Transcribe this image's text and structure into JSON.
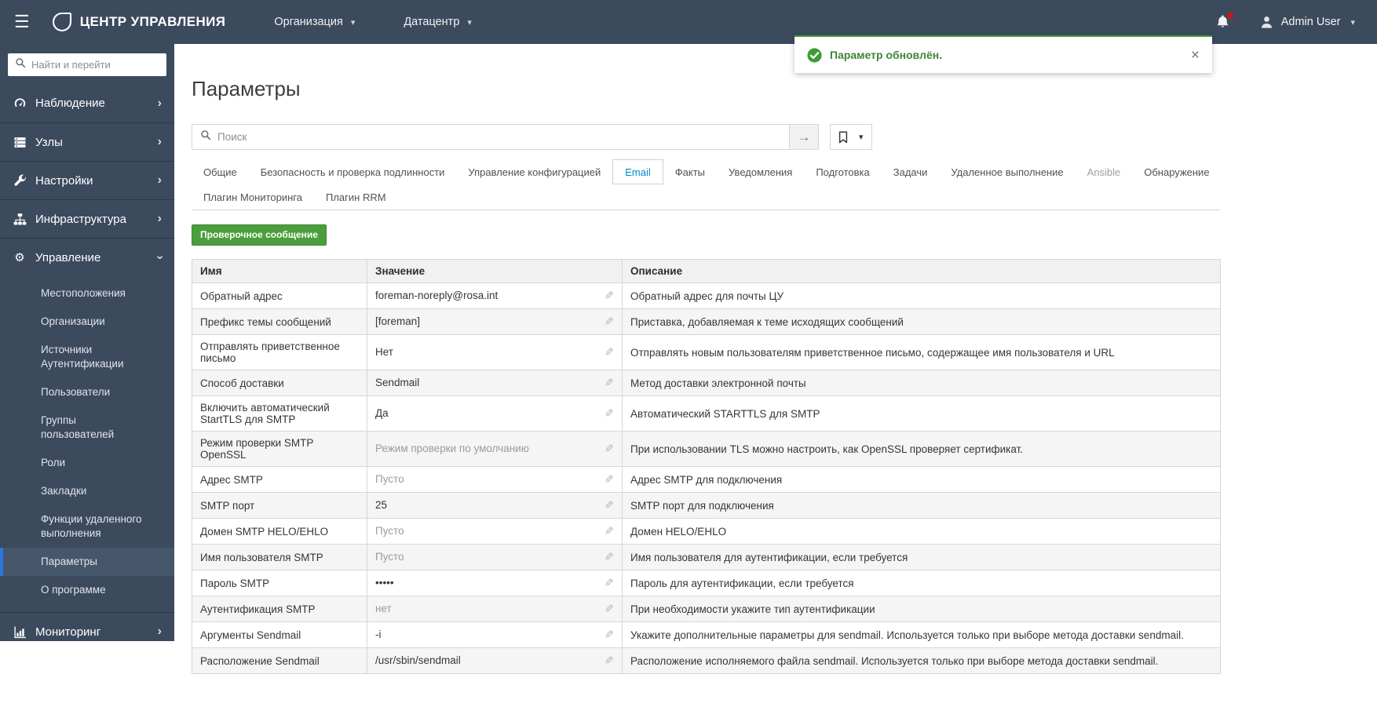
{
  "colors": {
    "header_bg": "#3c4a5e",
    "accent_blue": "#0088ce",
    "active_indicator_blue": "#2b77e0",
    "success_green": "#3f9c35",
    "button_green": "#4b9e3c",
    "notification_dot_red": "#c9190b"
  },
  "header": {
    "brand": "ЦЕНТР УПРАВЛЕНИЯ",
    "org_menu": "Организация",
    "dc_menu": "Датацентр",
    "user": "Admin User"
  },
  "toast": {
    "message": "Параметр обновлён.",
    "close_label": "×"
  },
  "sidebar": {
    "search_placeholder": "Найти и перейти",
    "items": [
      {
        "label": "Наблюдение",
        "icon": "gauge-icon"
      },
      {
        "label": "Узлы",
        "icon": "servers-icon"
      },
      {
        "label": "Настройки",
        "icon": "wrench-icon"
      },
      {
        "label": "Инфраструктура",
        "icon": "sitemap-icon"
      },
      {
        "label": "Управление",
        "icon": "gear-icon",
        "expanded": true,
        "children": [
          {
            "label": "Местоположения"
          },
          {
            "label": "Организации"
          },
          {
            "label": "Источники Аутентификации"
          },
          {
            "label": "Пользователи"
          },
          {
            "label": "Группы пользователей"
          },
          {
            "label": "Роли"
          },
          {
            "label": "Закладки"
          },
          {
            "label": "Функции удаленного выполнения"
          },
          {
            "label": "Параметры",
            "active": true
          },
          {
            "label": "О программе"
          }
        ]
      },
      {
        "label": "Мониторинг",
        "icon": "bar-chart-icon"
      }
    ]
  },
  "main": {
    "title": "Параметры",
    "search": {
      "placeholder": "Поиск"
    },
    "tabs": [
      {
        "label": "Общие",
        "row": 1
      },
      {
        "label": "Безопасность и проверка подлинности",
        "row": 1
      },
      {
        "label": "Управление конфигурацией",
        "row": 1
      },
      {
        "label": "Email",
        "row": 1,
        "active": true
      },
      {
        "label": "Факты",
        "row": 1
      },
      {
        "label": "Уведомления",
        "row": 1
      },
      {
        "label": "Подготовка",
        "row": 1
      },
      {
        "label": "Задачи",
        "row": 1
      },
      {
        "label": "Удаленное выполнение",
        "row": 1
      },
      {
        "label": "Ansible",
        "row": 1,
        "muted": true
      },
      {
        "label": "Обнаружение",
        "row": 1
      },
      {
        "label": "Плагин Мониторинга",
        "row": 2
      },
      {
        "label": "Плагин RRM",
        "row": 2
      }
    ],
    "test_button": "Проверочное сообщение",
    "table": {
      "columns": [
        "Имя",
        "Значение",
        "Описание"
      ],
      "rows": [
        {
          "name": "Обратный адрес",
          "value": "foreman-noreply@rosa.int",
          "value_muted": false,
          "description": "Обратный адрес для почты ЦУ"
        },
        {
          "name": "Префикс темы сообщений",
          "value": "[foreman]",
          "value_muted": false,
          "description": "Приставка, добавляемая к теме исходящих сообщений"
        },
        {
          "name": "Отправлять приветственное письмо",
          "value": "Нет",
          "value_muted": false,
          "description": "Отправлять новым пользователям приветственное письмо, содержащее имя пользователя и URL"
        },
        {
          "name": "Способ доставки",
          "value": "Sendmail",
          "value_muted": false,
          "description": "Метод доставки электронной почты"
        },
        {
          "name": "Включить автоматический StartTLS для SMTP",
          "value": "Да",
          "value_muted": false,
          "description": "Автоматический STARTTLS для SMTP"
        },
        {
          "name": "Режим проверки SMTP OpenSSL",
          "value": "Режим проверки по умолчанию",
          "value_muted": true,
          "description": "При использовании TLS можно настроить, как OpenSSL проверяет сертификат."
        },
        {
          "name": "Адрес SMTP",
          "value": "Пусто",
          "value_muted": true,
          "description": "Адрес SMTP для подключения"
        },
        {
          "name": "SMTP порт",
          "value": "25",
          "value_muted": false,
          "description": "SMTP порт для подключения"
        },
        {
          "name": "Домен SMTP HELO/EHLO",
          "value": "Пусто",
          "value_muted": true,
          "description": "Домен HELO/EHLO"
        },
        {
          "name": "Имя пользователя SMTP",
          "value": "Пусто",
          "value_muted": true,
          "description": "Имя пользователя для аутентификации, если требуется"
        },
        {
          "name": "Пароль SMTP",
          "value": "•••••",
          "value_muted": false,
          "description": "Пароль для аутентификации, если требуется"
        },
        {
          "name": "Аутентификация SMTP",
          "value": "нет",
          "value_muted": true,
          "description": "При необходимости укажите тип аутентификации"
        },
        {
          "name": "Аргументы Sendmail",
          "value": "-i",
          "value_muted": false,
          "description": "Укажите дополнительные параметры для sendmail. Используется только при выборе метода доставки sendmail."
        },
        {
          "name": "Расположение Sendmail",
          "value": "/usr/sbin/sendmail",
          "value_muted": false,
          "description": "Расположение исполняемого файла sendmail. Используется только при выборе метода доставки sendmail."
        }
      ]
    }
  }
}
